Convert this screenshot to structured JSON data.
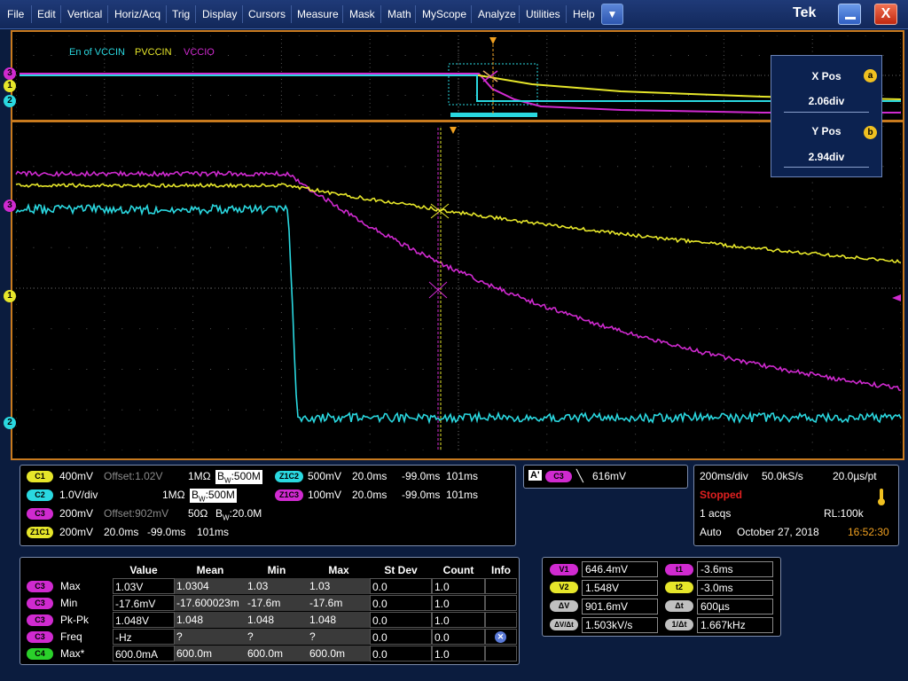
{
  "menu": {
    "items": [
      "File",
      "Edit",
      "Vertical",
      "Horiz/Acq",
      "Trig",
      "Display",
      "Cursors",
      "Measure",
      "Mask",
      "Math",
      "MyScope",
      "Analyze",
      "Utilities",
      "Help"
    ],
    "dropdown_glyph": "▼",
    "logo": "Tek",
    "close_glyph": "X"
  },
  "legend": {
    "en_vccin": "En of VCCIN",
    "pvccin": "PVCCIN",
    "vccio": "VCCIO"
  },
  "markers": {
    "ch1": "1",
    "ch2": "2",
    "ch3": "3",
    "cursor_a": "a",
    "cursor_b": "b"
  },
  "cursor_popup": {
    "x_label": "X Pos",
    "x_value": "2.06div",
    "y_label": "Y Pos",
    "y_value": "2.94div"
  },
  "channels": {
    "c1": {
      "tag": "C1",
      "scale": "400mV",
      "offset": "Offset:1.02V",
      "imp": "1MΩ",
      "bw_prefix": "B",
      "bw_sub": "W",
      "bw": ":500M"
    },
    "c2": {
      "tag": "C2",
      "scale": "1.0V/div",
      "imp": "1MΩ",
      "bw_prefix": "B",
      "bw_sub": "W",
      "bw": ":500M"
    },
    "c3": {
      "tag": "C3",
      "scale": "200mV",
      "offset": "Offset:902mV",
      "imp": "50Ω",
      "bw_prefix": "B",
      "bw_sub": "W",
      "bw": ":20.0M"
    },
    "z1c1": {
      "tag": "Z1C1",
      "scale": "200mV",
      "t1": "20.0ms",
      "t2": "-99.0ms",
      "t3": "101ms"
    },
    "z1c2": {
      "tag": "Z1C2",
      "scale": "500mV",
      "t1": "20.0ms",
      "t2": "-99.0ms",
      "t3": "101ms"
    },
    "z1c3": {
      "tag": "Z1C3",
      "scale": "100mV",
      "t1": "20.0ms",
      "t2": "-99.0ms",
      "t3": "101ms"
    }
  },
  "trigger": {
    "a_label": "A'",
    "source": "C3",
    "slope": "╲",
    "level": "616mV"
  },
  "acq": {
    "timebase": "200ms/div",
    "sample_rate": "50.0kS/s",
    "resolution": "20.0µs/pt",
    "state": "Stopped",
    "acqs": "1 acqs",
    "record_length": "RL:100k",
    "mode": "Auto",
    "date": "October 27, 2018",
    "time": "16:52:30"
  },
  "measurements": {
    "headers": [
      "Value",
      "Mean",
      "Min",
      "Max",
      "St Dev",
      "Count",
      "Info"
    ],
    "rows": [
      {
        "src": "C3",
        "name": "Max",
        "value": "1.03V",
        "mean": "1.0304",
        "min": "1.03",
        "max": "1.03",
        "stdev": "0.0",
        "count": "1.0"
      },
      {
        "src": "C3",
        "name": "Min",
        "value": "-17.6mV",
        "mean": "-17.600023m",
        "min": "-17.6m",
        "max": "-17.6m",
        "stdev": "0.0",
        "count": "1.0"
      },
      {
        "src": "C3",
        "name": "Pk-Pk",
        "value": "1.048V",
        "mean": "1.048",
        "min": "1.048",
        "max": "1.048",
        "stdev": "0.0",
        "count": "1.0"
      },
      {
        "src": "C3",
        "name": "Freq",
        "value": "-Hz",
        "mean": "?",
        "min": "?",
        "max": "?",
        "stdev": "0.0",
        "count": "0.0"
      },
      {
        "src": "C4",
        "name": "Max*",
        "value": "600.0mA",
        "mean": "600.0m",
        "min": "600.0m",
        "max": "600.0m",
        "stdev": "0.0",
        "count": "1.0"
      }
    ]
  },
  "cursors": {
    "v1_label": "V1",
    "v1": "646.4mV",
    "v2_label": "V2",
    "v2": "1.548V",
    "dv_label": "ΔV",
    "dv": "901.6mV",
    "dvdt_label": "ΔV/Δt",
    "dvdt": "1.503kV/s",
    "t1_label": "t1",
    "t1": "-3.6ms",
    "t2_label": "t2",
    "t2": "-3.0ms",
    "dt_label": "Δt",
    "dt": "600µs",
    "inv_label": "1/Δt",
    "inv": "1.667kHz"
  },
  "colors": {
    "ch1": "#e6e62a",
    "ch2": "#2ad8e0",
    "ch3": "#d02ad0",
    "ch4": "#2ad02a",
    "frame": "#c87a1e"
  }
}
